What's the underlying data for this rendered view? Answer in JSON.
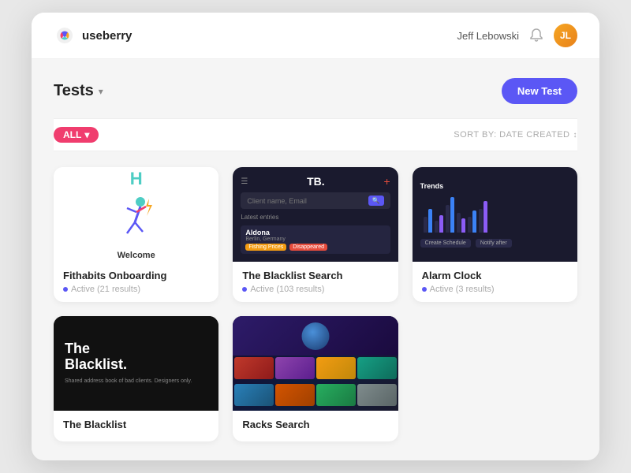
{
  "app": {
    "name": "useberry"
  },
  "header": {
    "user_name": "Jeff Lebowski",
    "avatar_initials": "JL",
    "bell_label": "notifications"
  },
  "page": {
    "title": "Tests",
    "title_dropdown_label": "Tests dropdown",
    "new_test_label": "New Test",
    "filter_all_label": "ALL",
    "sort_label": "SORT BY: DATE CREATED"
  },
  "cards": [
    {
      "id": "fithabits",
      "title": "Fithabits Onboarding",
      "status": "Active (21 results)",
      "preview_type": "fithabits"
    },
    {
      "id": "blacklist-search",
      "title": "The Blacklist Search",
      "status": "Active (103 results)",
      "preview_type": "blacklist-search"
    },
    {
      "id": "alarm-clock",
      "title": "Alarm Clock",
      "status": "Active (3 results)",
      "preview_type": "alarm-clock"
    },
    {
      "id": "blacklist-poster",
      "title": "The Blacklist",
      "status": "",
      "preview_type": "blacklist-poster",
      "poster_title": "The\nBlacklist.",
      "poster_sub": "Shared address book of bad clients.\nDesigners only."
    },
    {
      "id": "tracks",
      "title": "Racks  Search",
      "status": "",
      "preview_type": "tracks"
    }
  ],
  "blacklist_card": {
    "brand": "TB.",
    "search_placeholder": "Client name, Email",
    "latest_entries": "Latest entries",
    "item_name": "Aldona",
    "item_location": "Berlin, Germany",
    "tag1": "Fishing Prices",
    "tag2": "Disappeared"
  },
  "alarm_card": {
    "title": "Trends",
    "btn1": "Create Schedule",
    "btn2": "Notify after"
  }
}
